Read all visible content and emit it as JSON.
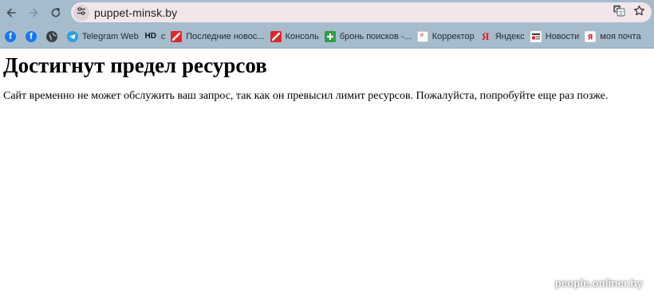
{
  "toolbar": {
    "back_icon": "arrow-left-icon",
    "forward_icon": "arrow-right-icon",
    "reload_icon": "reload-icon",
    "url": "puppet-minsk.by",
    "site_info_icon": "tune-icon",
    "translate_icon": "translate-icon",
    "bookmark_icon": "star-icon"
  },
  "bookmarks": [
    {
      "label": "",
      "icon": "facebook-icon"
    },
    {
      "label": "",
      "icon": "facebook-icon"
    },
    {
      "label": "",
      "icon": "globe-icon"
    },
    {
      "label": "Telegram Web",
      "icon": "telegram-icon"
    },
    {
      "label": "с",
      "icon": "hd-icon",
      "icon_text": "HD"
    },
    {
      "label": "Последние новос...",
      "icon": "onliner-icon"
    },
    {
      "label": "Консоль",
      "icon": "onliner-icon"
    },
    {
      "label": "бронь поисков -...",
      "icon": "google-sheets-icon"
    },
    {
      "label": "Корректор",
      "icon": "document-icon"
    },
    {
      "label": "Яндекс",
      "icon": "yandex-icon"
    },
    {
      "label": "Новости",
      "icon": "news-icon"
    },
    {
      "label": "моя почта",
      "icon": "yandex-mail-icon"
    }
  ],
  "page": {
    "heading": "Достигнут предел ресурсов",
    "message": "Сайт временно не может обслужить ваш запрос, так как он превысил лимит ресурсов. Пожалуйста, попробуйте еще раз позже."
  },
  "watermark": "people.onliner.by",
  "colors": {
    "toolbar_bg": "#a6bccd",
    "omnibox_bg": "#f2e6ea",
    "facebook": "#1877f2",
    "telegram": "#2aa3df",
    "onliner_red": "#e0262b",
    "sheets_green": "#2f9e44",
    "yandex_red": "#e01e1e"
  }
}
